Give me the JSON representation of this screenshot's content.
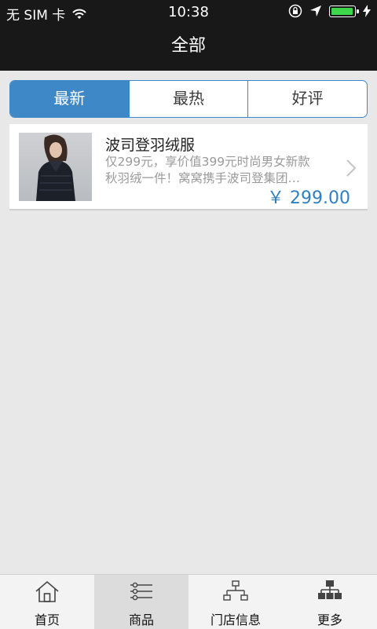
{
  "status_bar": {
    "carrier": "无 SIM 卡",
    "time": "10:38",
    "battery_level": 1.0
  },
  "nav": {
    "title": "全部"
  },
  "segments": [
    {
      "label": "最新",
      "active": true
    },
    {
      "label": "最热",
      "active": false
    },
    {
      "label": "好评",
      "active": false
    }
  ],
  "products": [
    {
      "title": "波司登羽绒服",
      "desc_line1": "仅299元，享价值399元时尚男女新款",
      "desc_line2": "秋羽绒一件！窝窝携手波司登集团…",
      "price": "￥ 299.00"
    }
  ],
  "tabs": [
    {
      "label": "首页",
      "icon": "home-icon"
    },
    {
      "label": "商品",
      "icon": "list-icon"
    },
    {
      "label": "门店信息",
      "icon": "store-hierarchy-icon"
    },
    {
      "label": "更多",
      "icon": "more-grid-icon"
    }
  ],
  "colors": {
    "accent": "#3f88c8",
    "bar_dark": "#181818",
    "battery": "#3dd54a",
    "price": "#2f7fc3"
  }
}
